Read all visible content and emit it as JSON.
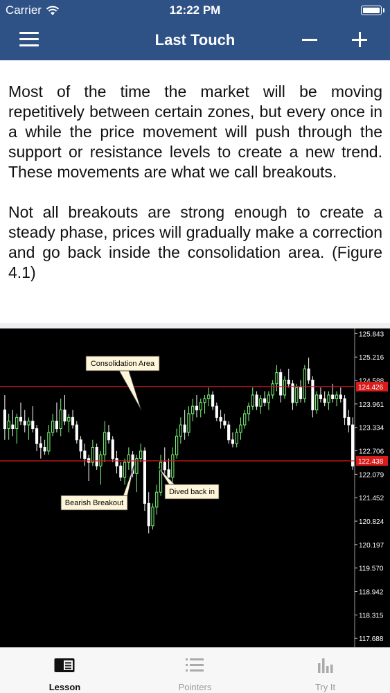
{
  "status_bar": {
    "carrier": "Carrier",
    "time": "12:22 PM"
  },
  "nav": {
    "title": "Last Touch",
    "icons": [
      "menu-icon",
      "minus-icon",
      "plus-icon"
    ]
  },
  "lesson": {
    "paragraphs": [
      "Most of the time the market will be moving repetitively between certain zones, but every once in a while the price movement will push through the support or resistance levels to create a new trend. These movements are what we call breakouts.",
      "Not all breakouts are strong enough to create a steady phase, prices will gradually make a correction and go back inside the consolidation area. (Figure 4.1)"
    ]
  },
  "chart_data": {
    "type": "candlestick",
    "background": "#000000",
    "bull_color": "#7cff7c",
    "bear_color": "#ffffff",
    "level_color": "#d81b1b",
    "y_ticks": [
      125.843,
      125.216,
      124.588,
      123.961,
      123.334,
      122.706,
      122.079,
      121.452,
      120.824,
      120.197,
      119.57,
      118.942,
      118.315,
      117.688
    ],
    "ylim": [
      117.45,
      125.98
    ],
    "levels": [
      {
        "value": 124.426,
        "label": "124.426"
      },
      {
        "value": 122.438,
        "label": "122.438"
      }
    ],
    "annotations": [
      {
        "text": "Consolidation Area",
        "points_to": 124.0
      },
      {
        "text": "Bearish Breakout",
        "points_to": 122.3
      },
      {
        "text": "Dived back in",
        "points_to": 122.0
      }
    ],
    "candles": [
      [
        123.8,
        124.2,
        123.0,
        123.3
      ],
      [
        123.3,
        123.7,
        123.0,
        123.5
      ],
      [
        123.4,
        123.8,
        123.1,
        123.3
      ],
      [
        123.3,
        123.7,
        122.9,
        123.6
      ],
      [
        123.6,
        124.0,
        123.4,
        123.5
      ],
      [
        123.5,
        123.8,
        123.2,
        123.4
      ],
      [
        123.4,
        123.6,
        123.0,
        123.5
      ],
      [
        123.5,
        123.9,
        123.2,
        123.3
      ],
      [
        123.3,
        123.4,
        122.7,
        122.9
      ],
      [
        122.9,
        123.1,
        122.5,
        122.8
      ],
      [
        122.8,
        123.0,
        122.6,
        122.7
      ],
      [
        122.7,
        123.4,
        122.6,
        123.2
      ],
      [
        123.2,
        123.7,
        123.1,
        123.5
      ],
      [
        123.5,
        124.0,
        123.2,
        123.3
      ],
      [
        123.3,
        124.1,
        123.1,
        123.8
      ],
      [
        123.8,
        124.2,
        123.4,
        123.5
      ],
      [
        123.5,
        123.7,
        123.2,
        123.6
      ],
      [
        123.6,
        123.8,
        123.3,
        123.4
      ],
      [
        123.4,
        123.5,
        122.9,
        123.0
      ],
      [
        123.0,
        123.1,
        122.5,
        122.7
      ],
      [
        122.7,
        122.9,
        122.3,
        122.5
      ],
      [
        122.5,
        122.6,
        121.9,
        122.4
      ],
      [
        122.4,
        123.0,
        122.3,
        122.8
      ],
      [
        122.8,
        122.9,
        122.2,
        122.3
      ],
      [
        122.3,
        122.7,
        121.8,
        122.6
      ],
      [
        122.6,
        123.5,
        122.4,
        123.2
      ],
      [
        123.2,
        123.4,
        122.9,
        123.0
      ],
      [
        123.0,
        123.1,
        122.4,
        122.5
      ],
      [
        122.5,
        122.7,
        122.1,
        122.3
      ],
      [
        122.3,
        122.4,
        121.9,
        122.0
      ],
      [
        122.0,
        122.5,
        121.8,
        122.4
      ],
      [
        122.4,
        122.8,
        122.2,
        122.6
      ],
      [
        122.6,
        122.7,
        122.0,
        122.1
      ],
      [
        122.1,
        122.6,
        121.6,
        122.5
      ],
      [
        122.5,
        122.9,
        122.4,
        122.7
      ],
      [
        122.7,
        122.8,
        121.1,
        121.3
      ],
      [
        121.3,
        121.6,
        120.5,
        120.7
      ],
      [
        120.7,
        121.3,
        120.6,
        121.2
      ],
      [
        121.2,
        121.8,
        121.0,
        121.6
      ],
      [
        121.6,
        122.6,
        121.5,
        122.4
      ],
      [
        122.4,
        122.8,
        122.0,
        122.2
      ],
      [
        122.2,
        122.5,
        121.9,
        122.0
      ],
      [
        122.0,
        122.8,
        121.8,
        122.6
      ],
      [
        122.6,
        123.3,
        122.5,
        123.1
      ],
      [
        123.1,
        123.6,
        122.9,
        123.4
      ],
      [
        123.4,
        123.8,
        123.0,
        123.2
      ],
      [
        123.2,
        123.9,
        123.1,
        123.7
      ],
      [
        123.7,
        124.1,
        123.5,
        123.9
      ],
      [
        123.9,
        124.2,
        123.6,
        123.8
      ],
      [
        123.8,
        124.1,
        123.6,
        124.0
      ],
      [
        124.0,
        124.2,
        123.7,
        124.1
      ],
      [
        124.1,
        124.4,
        123.9,
        124.2
      ],
      [
        124.2,
        124.3,
        123.8,
        123.9
      ],
      [
        123.9,
        124.0,
        123.5,
        123.6
      ],
      [
        123.6,
        123.8,
        123.3,
        123.5
      ],
      [
        123.5,
        123.7,
        123.3,
        123.4
      ],
      [
        123.4,
        123.5,
        122.9,
        123.0
      ],
      [
        123.0,
        123.2,
        122.8,
        122.9
      ],
      [
        122.9,
        123.3,
        122.8,
        123.2
      ],
      [
        123.2,
        123.6,
        123.0,
        123.4
      ],
      [
        123.4,
        123.8,
        123.3,
        123.7
      ],
      [
        123.7,
        124.0,
        123.5,
        123.9
      ],
      [
        123.9,
        124.4,
        123.8,
        124.2
      ],
      [
        124.2,
        124.3,
        123.8,
        123.9
      ],
      [
        123.9,
        124.2,
        123.7,
        124.1
      ],
      [
        124.1,
        124.3,
        123.9,
        124.0
      ],
      [
        124.0,
        124.3,
        123.8,
        124.2
      ],
      [
        124.2,
        124.6,
        124.1,
        124.5
      ],
      [
        124.5,
        125.0,
        124.3,
        124.8
      ],
      [
        124.8,
        124.9,
        124.0,
        124.2
      ],
      [
        124.2,
        124.7,
        124.1,
        124.6
      ],
      [
        124.6,
        124.9,
        124.4,
        124.5
      ],
      [
        124.5,
        124.6,
        123.8,
        124.0
      ],
      [
        124.0,
        124.5,
        123.9,
        124.4
      ],
      [
        124.4,
        124.6,
        124.0,
        124.1
      ],
      [
        124.1,
        125.0,
        124.0,
        124.9
      ],
      [
        124.9,
        125.2,
        124.5,
        124.6
      ],
      [
        124.6,
        124.7,
        123.6,
        123.8
      ],
      [
        123.8,
        124.3,
        123.7,
        124.2
      ],
      [
        124.2,
        124.4,
        124.0,
        124.1
      ],
      [
        124.1,
        124.3,
        123.9,
        124.0
      ],
      [
        124.0,
        124.3,
        123.8,
        124.2
      ],
      [
        124.2,
        124.5,
        124.0,
        124.1
      ],
      [
        124.1,
        124.3,
        123.9,
        124.2
      ],
      [
        124.2,
        124.4,
        124.0,
        124.1
      ],
      [
        124.1,
        124.2,
        123.4,
        123.6
      ],
      [
        123.6,
        123.8,
        123.2,
        123.4
      ],
      [
        123.4,
        123.6,
        122.2,
        122.3
      ]
    ]
  },
  "tabbar": {
    "tabs": [
      {
        "label": "Lesson",
        "icon": "lesson-book-icon",
        "active": true
      },
      {
        "label": "Pointers",
        "icon": "list-icon",
        "active": false
      },
      {
        "label": "Try It",
        "icon": "bar-chart-icon",
        "active": false
      }
    ]
  }
}
